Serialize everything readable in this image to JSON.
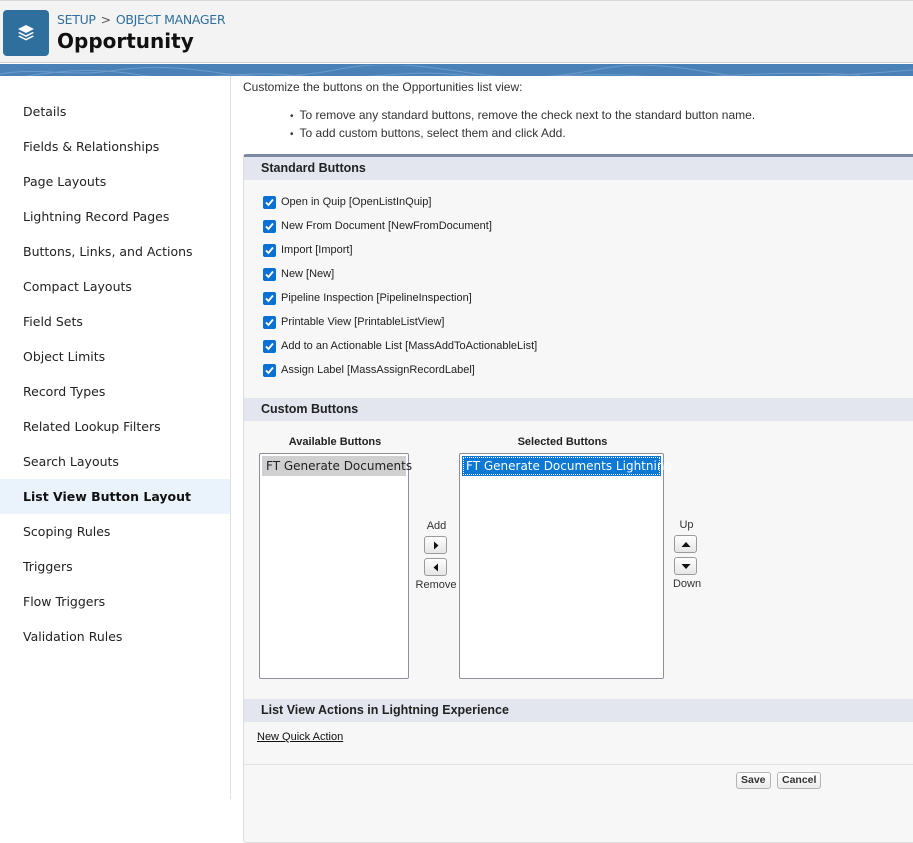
{
  "header": {
    "app_icon": "layers-icon",
    "breadcrumb": {
      "root": "SETUP",
      "separator": ">",
      "current": "OBJECT MANAGER"
    },
    "title": "Opportunity"
  },
  "sidebar": {
    "items": [
      {
        "label": "Details"
      },
      {
        "label": "Fields & Relationships"
      },
      {
        "label": "Page Layouts"
      },
      {
        "label": "Lightning Record Pages"
      },
      {
        "label": "Buttons, Links, and Actions"
      },
      {
        "label": "Compact Layouts"
      },
      {
        "label": "Field Sets"
      },
      {
        "label": "Object Limits"
      },
      {
        "label": "Record Types"
      },
      {
        "label": "Related Lookup Filters"
      },
      {
        "label": "Search Layouts"
      },
      {
        "label": "List View Button Layout",
        "active": true
      },
      {
        "label": "Scoping Rules"
      },
      {
        "label": "Triggers"
      },
      {
        "label": "Flow Triggers"
      },
      {
        "label": "Validation Rules"
      }
    ]
  },
  "main": {
    "intro": "Customize the buttons on the Opportunities list view:",
    "bullets": [
      "To remove any standard buttons, remove the check next to the standard button name.",
      "To add custom buttons, select them and click Add."
    ],
    "standard_buttons": {
      "heading": "Standard Buttons",
      "items": [
        {
          "label": "Open in Quip [OpenListInQuip]",
          "checked": true
        },
        {
          "label": "New From Document [NewFromDocument]",
          "checked": true
        },
        {
          "label": "Import [Import]",
          "checked": true
        },
        {
          "label": "New [New]",
          "checked": true
        },
        {
          "label": "Pipeline Inspection [PipelineInspection]",
          "checked": true
        },
        {
          "label": "Printable View [PrintableListView]",
          "checked": true
        },
        {
          "label": "Add to an Actionable List [MassAddToActionableList]",
          "checked": true
        },
        {
          "label": "Assign Label [MassAssignRecordLabel]",
          "checked": true
        }
      ]
    },
    "custom_buttons": {
      "heading": "Custom Buttons",
      "available_label": "Available Buttons",
      "available_options": [
        "FT Generate Documents"
      ],
      "selected_label": "Selected Buttons",
      "selected_options": [
        "FT Generate Documents Lightning"
      ],
      "add_label": "Add",
      "remove_label": "Remove",
      "up_label": "Up",
      "down_label": "Down"
    },
    "lightning_actions": {
      "heading": "List View Actions in Lightning Experience",
      "link": "New Quick Action"
    },
    "footer": {
      "save": "Save",
      "cancel": "Cancel"
    }
  }
}
